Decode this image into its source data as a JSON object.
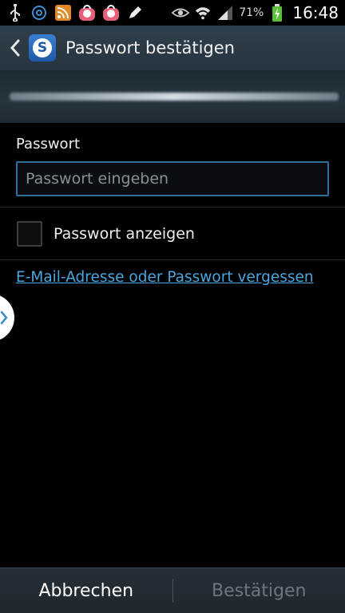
{
  "status_bar": {
    "left_icons": [
      "usb-icon",
      "at-sign-icon",
      "rss-icon",
      "shopping-bag-icon",
      "shopping-bag-icon",
      "pencil-icon"
    ],
    "right_icons": [
      "eye-icon",
      "wifi-icon",
      "signal-icon"
    ],
    "battery": "71%",
    "time": "16:48"
  },
  "action_bar": {
    "back_icon": "chevron-left-icon",
    "app_logo_letter": "S",
    "title": "Passwort bestätigen"
  },
  "form": {
    "password_label": "Passwort",
    "password_value": "",
    "password_placeholder": "Passwort eingeben",
    "show_password_label": "Passwort anzeigen",
    "show_password_checked": false,
    "forgot_link": "E-Mail-Adresse oder Passwort vergessen"
  },
  "bottom_bar": {
    "cancel_label": "Abbrechen",
    "confirm_label": "Bestätigen"
  },
  "colors": {
    "accent": "#4aa6de",
    "action_bar": "#2f3f4b",
    "input_border": "#2e6fa0",
    "disabled_text": "#6c767d"
  }
}
